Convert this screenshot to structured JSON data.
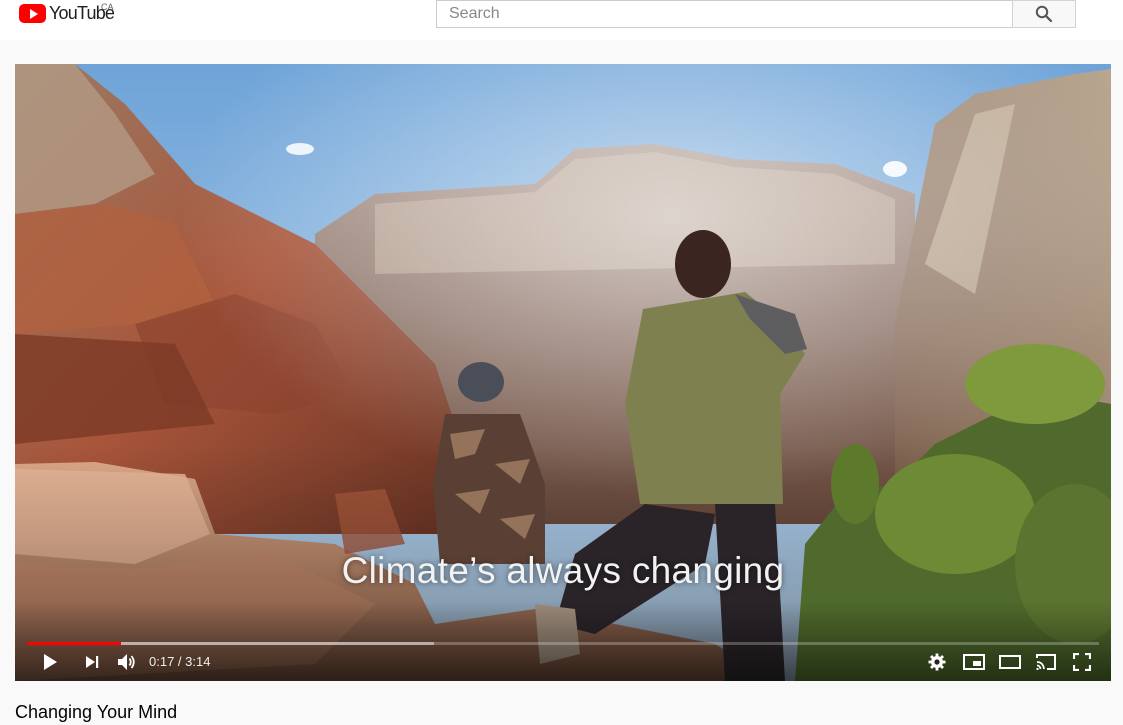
{
  "header": {
    "logo_text": "YouTube",
    "region": "CA",
    "search_placeholder": "Search",
    "search_icon": "search-icon"
  },
  "player": {
    "subtitle": "Climate’s always changing",
    "current_time": "0:17",
    "duration": "3:14",
    "time_display": "0:17 / 3:14",
    "progress_played": 0.0876,
    "progress_buffered": 0.38,
    "progress_color": "#ff0000",
    "icons": [
      "play-icon",
      "next-icon",
      "volume-icon",
      "settings-icon",
      "miniplayer-icon",
      "theater-icon",
      "cast-icon",
      "fullscreen-icon"
    ]
  },
  "video": {
    "title": "Changing Your Mind"
  },
  "colors": {
    "brand_red": "#ff0000"
  }
}
